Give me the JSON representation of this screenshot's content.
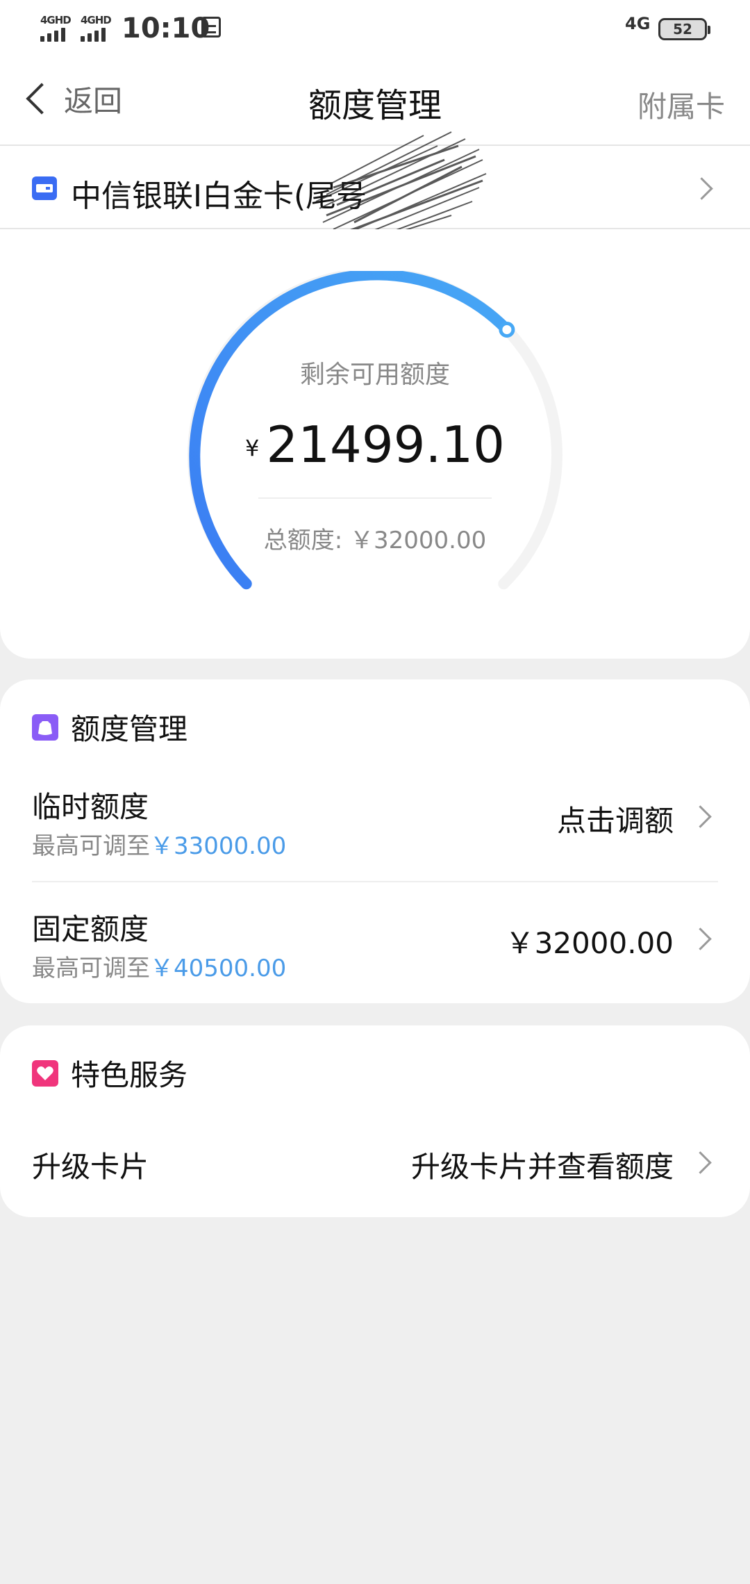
{
  "status_bar": {
    "signal1_label": "4GHD",
    "signal2_label": "4GHD",
    "time": "10:10",
    "network": "4G",
    "battery": "52"
  },
  "nav": {
    "back_label": "返回",
    "title": "额度管理",
    "right_label": "附属卡"
  },
  "card_selector": {
    "card_name": "中信银联I白金卡(尾号"
  },
  "gauge": {
    "label": "剩余可用额度",
    "currency": "¥",
    "available": "21499.10",
    "total_text": "总额度: ￥32000.00",
    "fill_fraction": 0.672,
    "color_start": "#3a7cf3",
    "color_end": "#47a8f5"
  },
  "limit_section": {
    "title": "额度管理",
    "icon": "bag-icon",
    "icon_color": "#8a5cf6",
    "rows": [
      {
        "title": "临时额度",
        "sub_prefix": "最高可调至",
        "sub_value": "￥33000.00",
        "right": "点击调额"
      },
      {
        "title": "固定额度",
        "sub_prefix": "最高可调至",
        "sub_value": "￥40500.00",
        "right": "￥32000.00"
      }
    ]
  },
  "service_section": {
    "title": "特色服务",
    "icon": "heart-icon",
    "icon_color": "#f0357c",
    "rows": [
      {
        "title": "升级卡片",
        "right": "升级卡片并查看额度"
      }
    ]
  }
}
